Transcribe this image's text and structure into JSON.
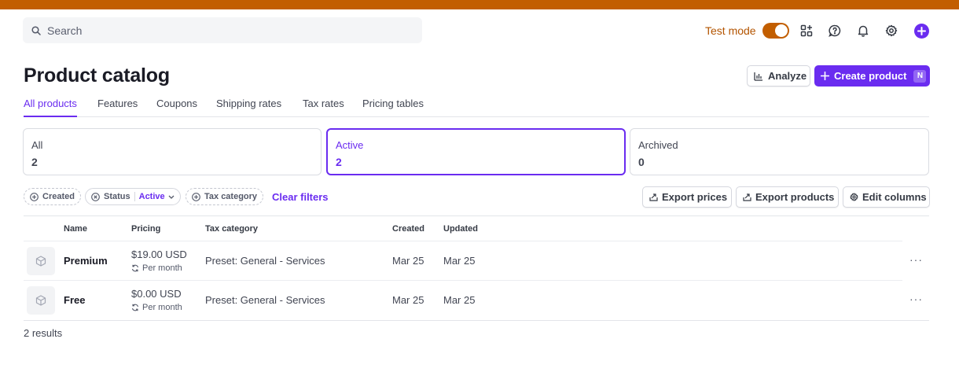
{
  "search": {
    "placeholder": "Search",
    "icon": "search-icon"
  },
  "topbar": {
    "accent_color": "#c25e00",
    "test_mode_label": "Test mode",
    "test_mode_on": true,
    "icons": [
      "apps-icon",
      "help-icon",
      "bell-icon",
      "gear-icon",
      "plus-icon"
    ]
  },
  "page": {
    "title": "Product catalog"
  },
  "actions": {
    "analyze": "Analyze",
    "create_product": "Create product",
    "create_shortcut": "N"
  },
  "tabs": [
    {
      "label": "All products",
      "active": true
    },
    {
      "label": "Features",
      "active": false
    },
    {
      "label": "Coupons",
      "active": false
    },
    {
      "label": "Shipping rates",
      "active": false
    },
    {
      "label": "Tax rates",
      "active": false
    },
    {
      "label": "Pricing tables",
      "active": false
    }
  ],
  "status_cards": [
    {
      "label": "All",
      "count": "2",
      "selected": false
    },
    {
      "label": "Active",
      "count": "2",
      "selected": true
    },
    {
      "label": "Archived",
      "count": "0",
      "selected": false
    }
  ],
  "filters": {
    "created": "Created",
    "status": "Status",
    "status_value": "Active",
    "tax_category": "Tax category",
    "clear": "Clear filters"
  },
  "toolbar": {
    "export_prices": "Export prices",
    "export_products": "Export products",
    "edit_columns": "Edit columns"
  },
  "table": {
    "columns": [
      "Name",
      "Pricing",
      "Tax category",
      "Created",
      "Updated"
    ],
    "rows": [
      {
        "name": "Premium",
        "price": "$19.00 USD",
        "period": "Per month",
        "tax": "Preset: General - Services",
        "created": "Mar 25",
        "updated": "Mar 25"
      },
      {
        "name": "Free",
        "price": "$0.00 USD",
        "period": "Per month",
        "tax": "Preset: General - Services",
        "created": "Mar 25",
        "updated": "Mar 25"
      }
    ],
    "more_label": "···"
  },
  "footer": {
    "results": "2 results"
  },
  "colors": {
    "brand": "#6a2cf0",
    "test_mode": "#c25e00"
  }
}
